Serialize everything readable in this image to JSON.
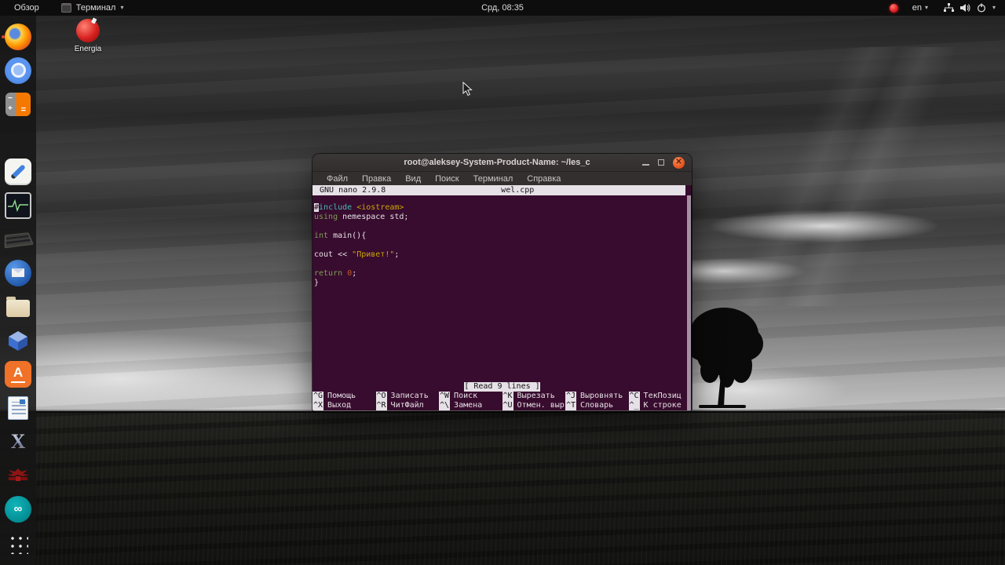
{
  "colors": {
    "topbar_bg": "#0D0D0D",
    "terminal_bg": "#380C2E",
    "close_button_orange": "#E95420",
    "record_red": "#E01B24",
    "nano_invert_bg": "#E6E1E6",
    "syntax": {
      "keyword_green": "#7D9C52",
      "preprocessor_cyan": "#46B8B8",
      "string_yellow": "#C9A305",
      "number_orange": "#C05A2B",
      "plain_text": "#E6E0E6"
    }
  },
  "topbar": {
    "activities_label": "Обзор",
    "focused_app_label": "Терминал",
    "clock": "Срд, 08:35",
    "keyboard_layout": "en",
    "status_icons": [
      "record-icon",
      "network-icon",
      "volume-icon",
      "power-icon",
      "dropdown-caret-icon"
    ]
  },
  "desktop": {
    "icons": [
      {
        "label": "Energia",
        "icon": "energia-red-sphere-icon"
      }
    ]
  },
  "dock": {
    "items": [
      "firefox",
      "chromium",
      "calculator",
      "color-tiles",
      "gedit",
      "oscilloscope",
      "keyboard",
      "thunderbird",
      "files",
      "virtualbox",
      "orange-a-app",
      "libreoffice-writer",
      "x-app",
      "eagle-emblem-game",
      "arduino",
      "show-applications"
    ],
    "running": [
      "firefox"
    ]
  },
  "terminal_window": {
    "title": "root@aleksey-System-Product-Name: ~/les_c",
    "window_controls": [
      "minimize",
      "maximize",
      "close"
    ],
    "close_glyph": "✕",
    "menu": [
      "Файл",
      "Правка",
      "Вид",
      "Поиск",
      "Терминал",
      "Справка"
    ],
    "nano": {
      "version_label": "GNU nano 2.9.8",
      "filename": "wel.cpp",
      "status_message": "[ Read 9 lines ]",
      "code": [
        [
          {
            "t": "#",
            "c": "cursor"
          },
          {
            "t": "include",
            "c": "cyan"
          },
          {
            "t": " ",
            "c": "plain"
          },
          {
            "t": "<iostream>",
            "c": "yellow"
          }
        ],
        [
          {
            "t": "using",
            "c": "green"
          },
          {
            "t": " nemespace std;",
            "c": "plain"
          }
        ],
        [],
        [
          {
            "t": "int",
            "c": "green"
          },
          {
            "t": " main(){",
            "c": "plain"
          }
        ],
        [],
        [
          {
            "t": "cout << ",
            "c": "plain"
          },
          {
            "t": "\"Привет!\"",
            "c": "yellow"
          },
          {
            "t": ";",
            "c": "plain"
          }
        ],
        [],
        [
          {
            "t": "return",
            "c": "green"
          },
          {
            "t": " ",
            "c": "plain"
          },
          {
            "t": "0",
            "c": "orange"
          },
          {
            "t": ";",
            "c": "plain"
          }
        ],
        [
          {
            "t": "}",
            "c": "plain"
          }
        ]
      ],
      "shortcuts": {
        "row1": [
          {
            "key": "^G",
            "label": "Помощь"
          },
          {
            "key": "^O",
            "label": "Записать"
          },
          {
            "key": "^W",
            "label": "Поиск"
          },
          {
            "key": "^K",
            "label": "Вырезать"
          },
          {
            "key": "^J",
            "label": "Выровнять"
          },
          {
            "key": "^C",
            "label": "ТекПозиц"
          }
        ],
        "row2": [
          {
            "key": "^X",
            "label": "Выход"
          },
          {
            "key": "^R",
            "label": "ЧитФайл"
          },
          {
            "key": "^\\",
            "label": "Замена"
          },
          {
            "key": "^U",
            "label": "Отмен. выр"
          },
          {
            "key": "^T",
            "label": "Словарь"
          },
          {
            "key": "^_",
            "label": "К строке"
          }
        ]
      }
    }
  }
}
